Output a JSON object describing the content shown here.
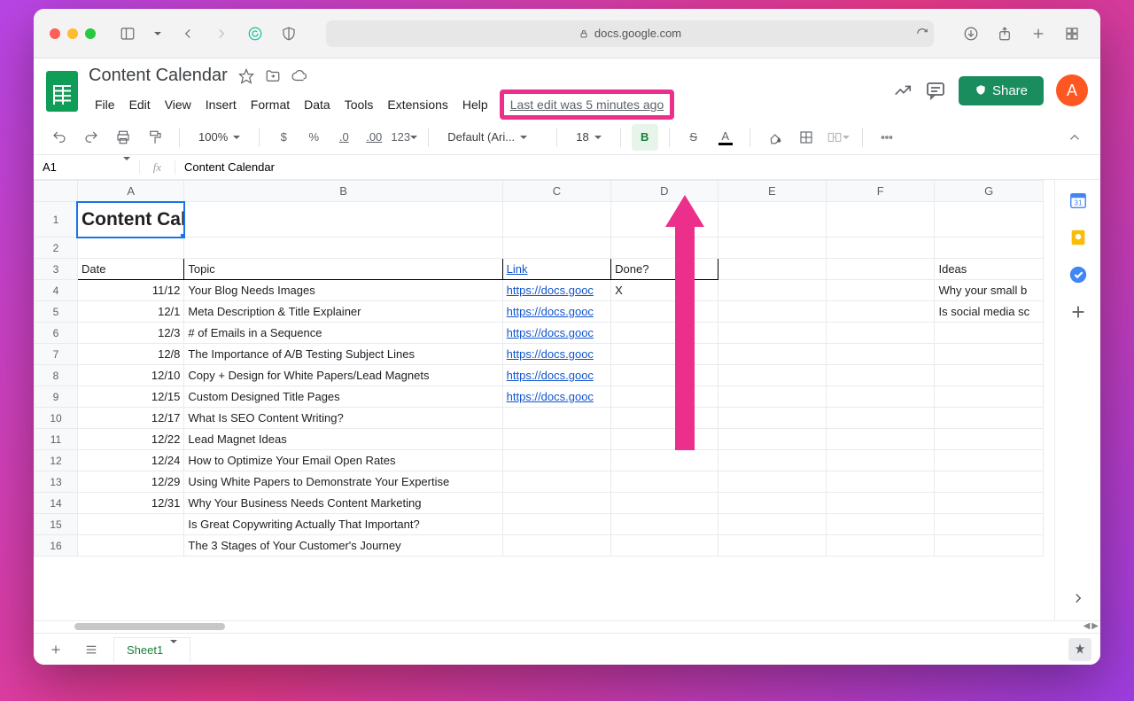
{
  "browser": {
    "url_host": "docs.google.com"
  },
  "doc": {
    "title": "Content Calendar",
    "menus": [
      "File",
      "Edit",
      "View",
      "Insert",
      "Format",
      "Data",
      "Tools",
      "Extensions",
      "Help"
    ],
    "last_edit": "Last edit was 5 minutes ago",
    "share_label": "Share",
    "avatar_initial": "A"
  },
  "toolbar": {
    "zoom": "100%",
    "format_buttons": [
      "$",
      "%",
      ".0",
      ".00",
      "123"
    ],
    "font": "Default (Ari...",
    "font_size": "18"
  },
  "namebox": "A1",
  "formula": "Content Calendar",
  "columns": [
    "A",
    "B",
    "C",
    "D",
    "E",
    "F",
    "G"
  ],
  "col_g_header": "Ideas",
  "rows": [
    {
      "n": 1,
      "type": "title",
      "a": "Content Calendar"
    },
    {
      "n": 2,
      "type": "blank"
    },
    {
      "n": 3,
      "type": "header",
      "a": "Date",
      "b": "Topic",
      "c": "Link",
      "d": "Done?",
      "g": "Ideas"
    },
    {
      "n": 4,
      "a": "11/12",
      "b": "Your Blog Needs Images",
      "c": "https://docs.gooc",
      "d": "X",
      "g": "Why your small b"
    },
    {
      "n": 5,
      "a": "12/1",
      "b": "Meta Description & Title Explainer",
      "c": "https://docs.gooc",
      "g": "Is social media sc"
    },
    {
      "n": 6,
      "a": "12/3",
      "b": "# of Emails in a Sequence",
      "c": "https://docs.gooc"
    },
    {
      "n": 7,
      "a": "12/8",
      "b": "The Importance of A/B Testing Subject Lines",
      "c": "https://docs.gooc"
    },
    {
      "n": 8,
      "a": "12/10",
      "b": "Copy + Design for White Papers/Lead Magnets",
      "c": "https://docs.gooc"
    },
    {
      "n": 9,
      "a": "12/15",
      "b": "Custom Designed Title Pages",
      "c": "https://docs.gooc"
    },
    {
      "n": 10,
      "a": "12/17",
      "b": "What Is SEO Content Writing?"
    },
    {
      "n": 11,
      "a": "12/22",
      "b": "Lead Magnet Ideas"
    },
    {
      "n": 12,
      "a": "12/24",
      "b": "How to Optimize Your Email Open Rates"
    },
    {
      "n": 13,
      "a": "12/29",
      "b": "Using White Papers to Demonstrate Your Expertise"
    },
    {
      "n": 14,
      "a": "12/31",
      "b": "Why Your Business Needs Content Marketing"
    },
    {
      "n": 15,
      "b": "Is Great Copywriting Actually That Important?"
    },
    {
      "n": 16,
      "b": "The 3 Stages of Your Customer's Journey"
    }
  ],
  "tabs": {
    "sheet1": "Sheet1"
  }
}
